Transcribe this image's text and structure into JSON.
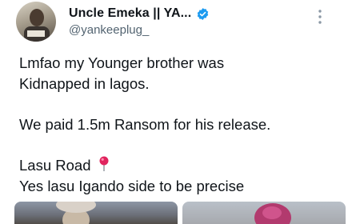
{
  "author": {
    "display_name": "Uncle Emeka || YA...",
    "handle": "@yankeeplug_",
    "verified_icon": "verified-badge-icon",
    "verified_color": "#1d9bf0"
  },
  "tweet": {
    "lines": [
      "Lmfao my Younger brother was",
      "Kidnapped in lagos.",
      "We paid 1.5m Ransom for his release.",
      "Lasu Road",
      "Yes lasu Igando side to be precise"
    ],
    "pin_icon": "round-pushpin-icon"
  },
  "media": {
    "photos": [
      {
        "icon": "photo-1"
      },
      {
        "icon": "photo-2"
      }
    ]
  },
  "menu_icon": "more-vertical-icon"
}
